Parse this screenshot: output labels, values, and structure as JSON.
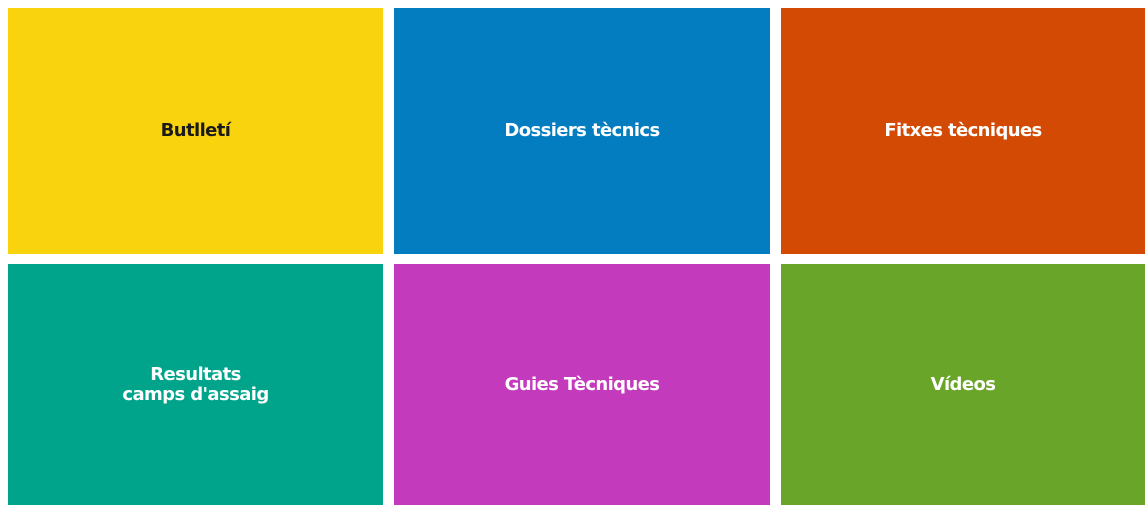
{
  "tiles": [
    {
      "label": "Butlletí",
      "bg": "#f9d30e",
      "fg": "#1a1a1a"
    },
    {
      "label": "Dossiers tècnics",
      "bg": "#047dc0",
      "fg": "#ffffff"
    },
    {
      "label": "Fitxes tècniques",
      "bg": "#d24a03",
      "fg": "#ffffff"
    },
    {
      "label": "Resultats\ncamps d'assaig",
      "bg": "#00a48b",
      "fg": "#ffffff"
    },
    {
      "label": "Guies Tècniques",
      "bg": "#c43abc",
      "fg": "#ffffff"
    },
    {
      "label": "Vídeos",
      "bg": "#68a528",
      "fg": "#ffffff"
    }
  ]
}
